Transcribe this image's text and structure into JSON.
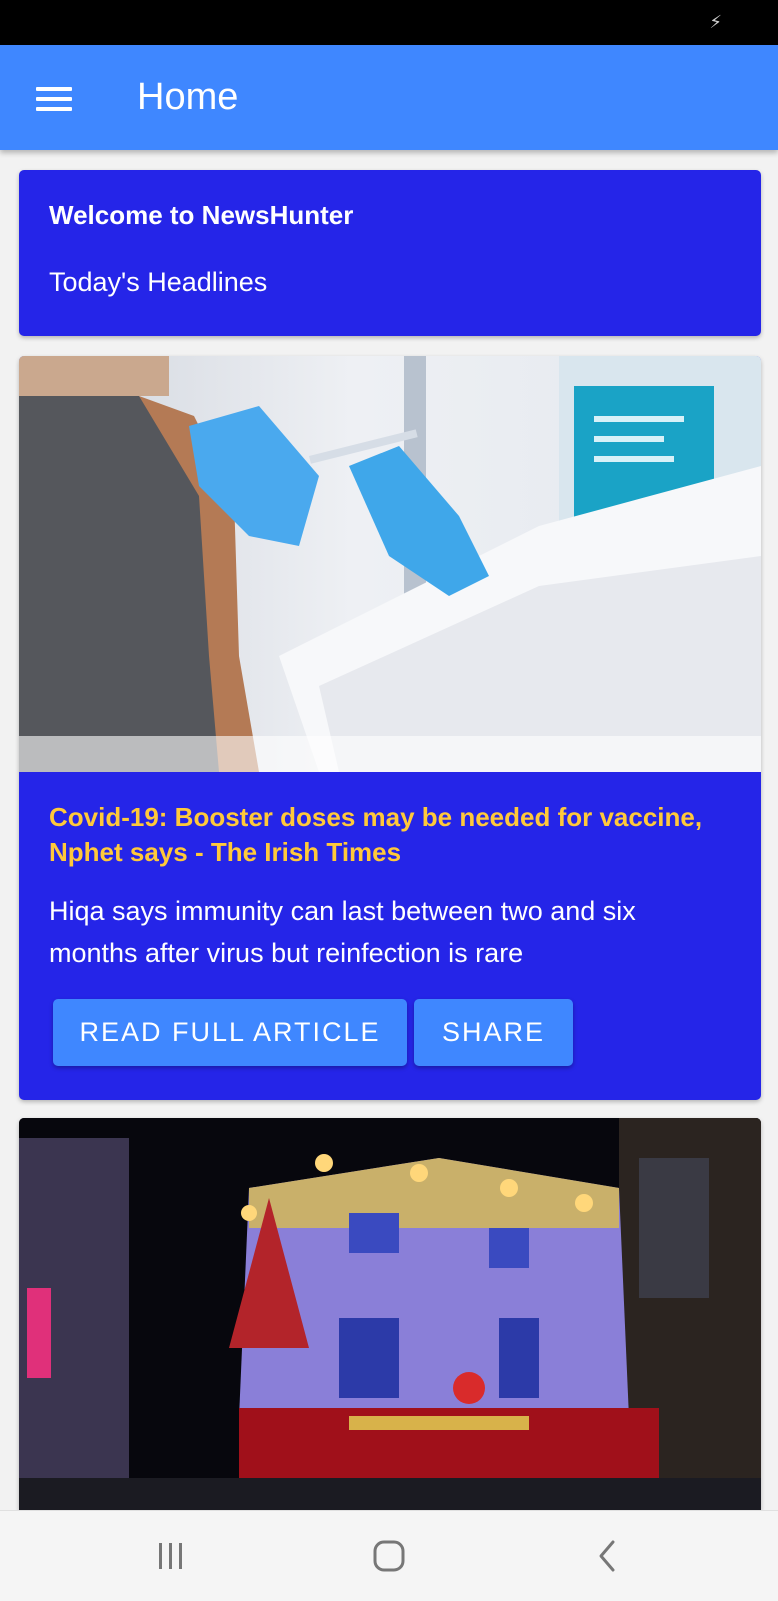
{
  "status_bar": {
    "charging_icon": "lightning-bolt-icon"
  },
  "app_bar": {
    "title": "Home",
    "menu_icon": "hamburger-menu-icon"
  },
  "welcome": {
    "title": "Welcome to NewsHunter",
    "subtitle": "Today's Headlines"
  },
  "articles": [
    {
      "image": "vaccination-photo",
      "title": "Covid-19: Booster doses may be needed for vaccine, Nphet says - The Irish Times",
      "description": "Hiqa says immunity can last between two and six months after virus but reinfection is rare",
      "read_label": "READ FULL ARTICLE",
      "share_label": "SHARE"
    },
    {
      "image": "temple-bar-night-photo"
    }
  ],
  "nav_bar": {
    "recents_icon": "recent-apps-icon",
    "home_icon": "home-icon",
    "back_icon": "back-icon"
  },
  "colors": {
    "app_bar": "#3f87ff",
    "card": "#2525e8",
    "headline": "#ffc93a",
    "button": "#3f87ff"
  }
}
